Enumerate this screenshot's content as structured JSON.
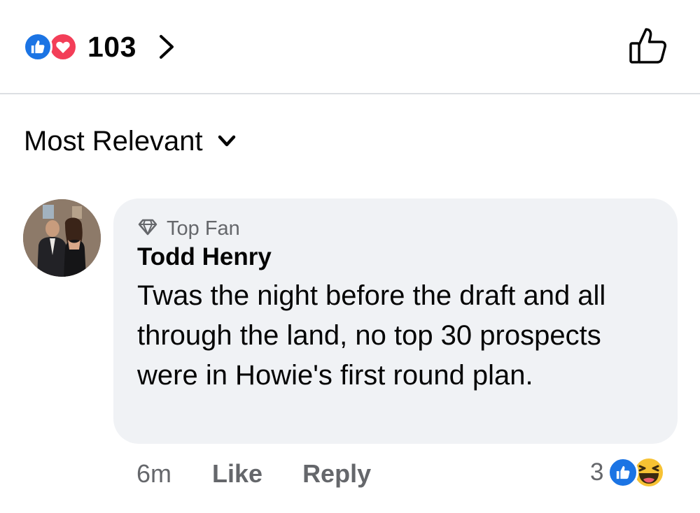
{
  "header": {
    "reaction_count": "103",
    "reaction_icons": [
      "like-icon",
      "love-icon"
    ],
    "like_button_icon": "thumbs-up-outline-icon"
  },
  "sort": {
    "label": "Most Relevant",
    "icon": "chevron-down-icon"
  },
  "comment": {
    "badge": "Top Fan",
    "badge_icon": "diamond-icon",
    "author": "Todd Henry",
    "text": "Twas the night before the draft and all through the land, no top 30 prospects were in Howie's first round plan.",
    "time": "6m",
    "like_label": "Like",
    "reply_label": "Reply",
    "reaction_count": "3",
    "reaction_icons": [
      "like-icon",
      "haha-icon"
    ]
  },
  "colors": {
    "like_blue": "#1b74e4",
    "love_red": "#f33e58",
    "bubble_bg": "#f0f2f5",
    "secondary_text": "#65676b",
    "haha_yellow": "#f7c233"
  }
}
